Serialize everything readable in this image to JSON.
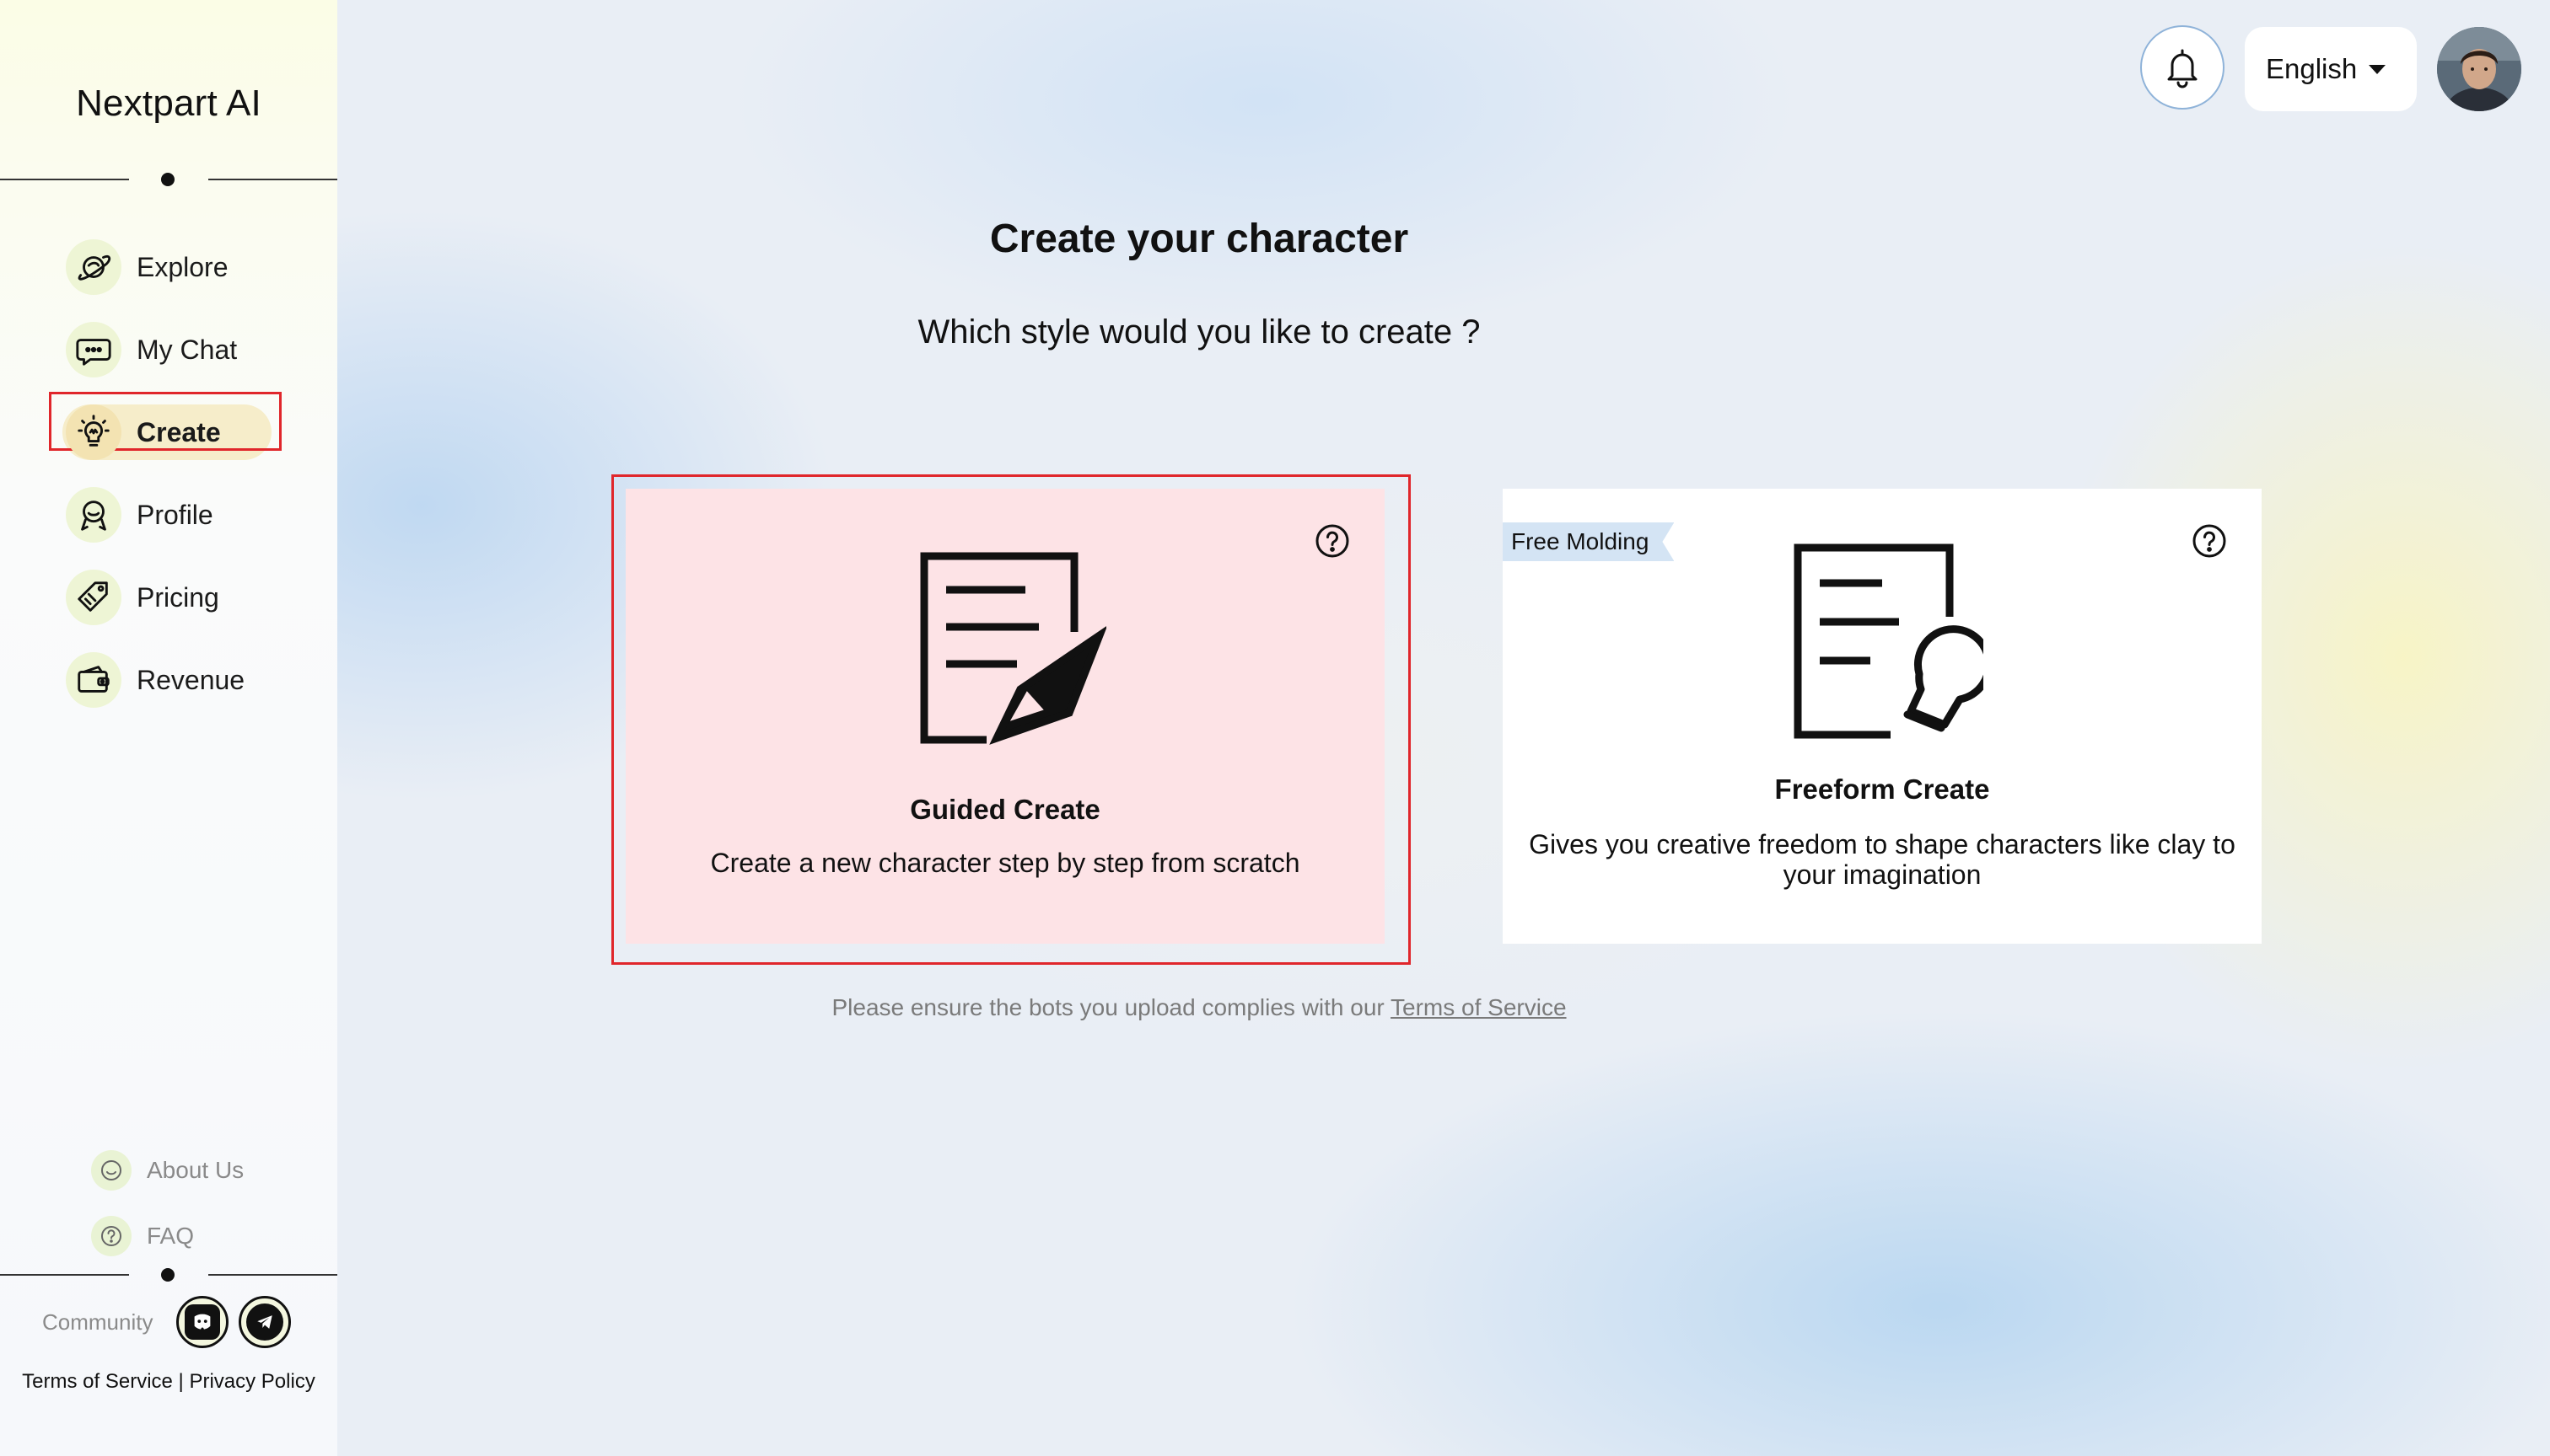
{
  "sidebar": {
    "brand": "Nextpart AI",
    "nav": [
      {
        "label": "Explore",
        "icon": "planet-icon"
      },
      {
        "label": "My Chat",
        "icon": "chat-bubble-icon"
      },
      {
        "label": "Create",
        "icon": "lightbulb-icon",
        "active": true
      },
      {
        "label": "Profile",
        "icon": "profile-badge-icon"
      },
      {
        "label": "Pricing",
        "icon": "price-tag-icon"
      },
      {
        "label": "Revenue",
        "icon": "wallet-icon"
      }
    ],
    "footer_links": [
      {
        "label": "About Us",
        "icon": "smile-icon"
      },
      {
        "label": "FAQ",
        "icon": "question-icon"
      }
    ],
    "community_label": "Community",
    "social": [
      "discord-icon",
      "telegram-icon"
    ],
    "terms": "Terms of Service",
    "separator": "|",
    "privacy": "Privacy Policy"
  },
  "header": {
    "language": "English"
  },
  "main": {
    "title": "Create your character",
    "subtitle": "Which style would you like to create ?",
    "cards": [
      {
        "title": "Guided Create",
        "description": "Create a new character step by step from scratch",
        "icon": "document-pen-icon",
        "selected": true
      },
      {
        "title": "Freeform Create",
        "description": "Gives you creative freedom to shape characters like clay to your imagination",
        "icon": "document-bulb-icon",
        "badge": "Free Molding"
      }
    ],
    "notice_prefix": "Please ensure the bots you upload complies with our",
    "notice_link": "Terms of Service"
  },
  "colors": {
    "highlight": "#e0262b",
    "guided_card_bg": "#fde3e6",
    "active_pill": "#f6edca",
    "ribbon": "#d4e4f4"
  }
}
